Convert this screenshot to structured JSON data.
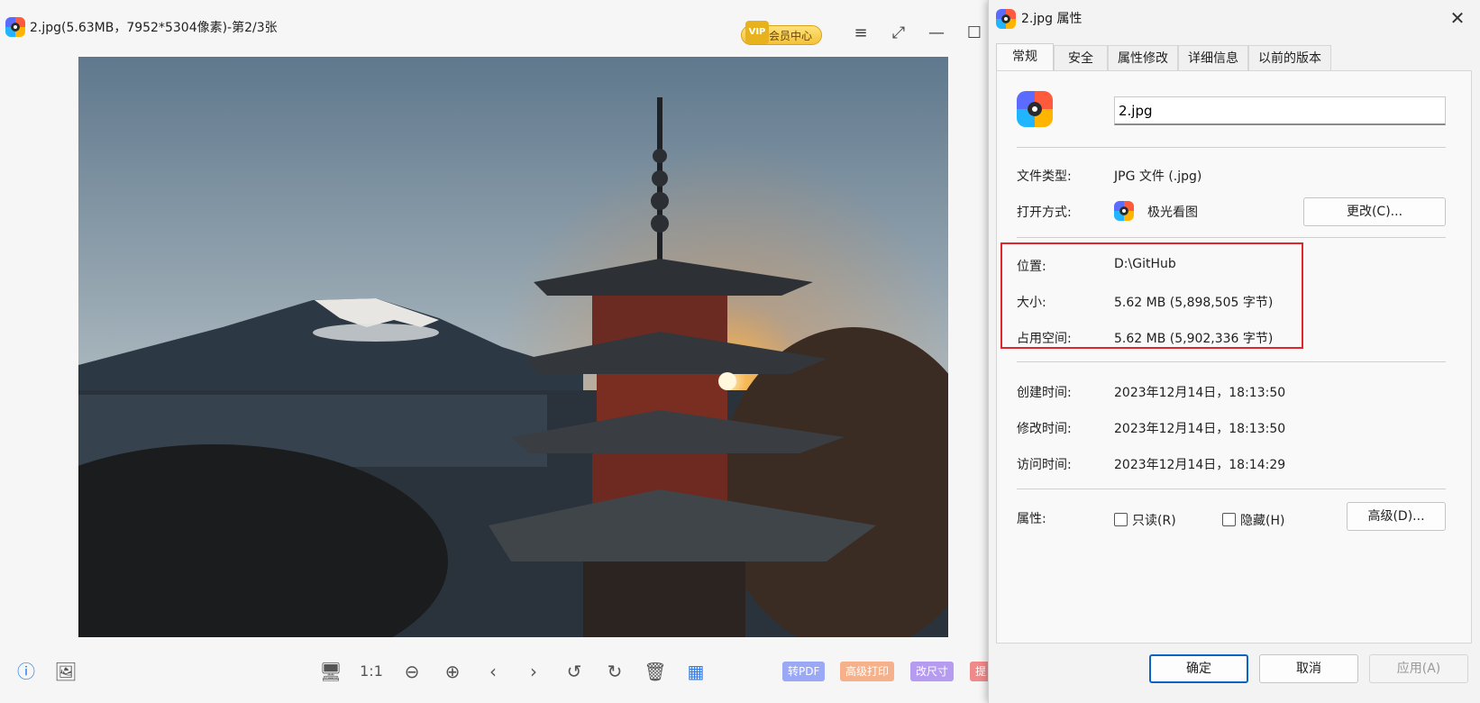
{
  "viewer": {
    "title": "2.jpg(5.63MB，7952*5304像素)-第2/3张",
    "vip_label": "会员中心",
    "vip_crown": "VIP",
    "image_description_icon": "photo",
    "tags": [
      "转PDF",
      "高级打印",
      "改尺寸",
      "提"
    ]
  },
  "dialog": {
    "title": "2.jpg 属性",
    "tabs": [
      "常规",
      "安全",
      "属性修改",
      "详细信息",
      "以前的版本"
    ],
    "file_name": "2.jpg",
    "rows": {
      "file_type_label": "文件类型:",
      "file_type_value": "JPG 文件 (.jpg)",
      "open_with_label": "打开方式:",
      "open_with_value": "极光看图",
      "change_button": "更改(C)...",
      "location_label": "位置:",
      "location_value": "D:\\GitHub",
      "size_label": "大小:",
      "size_value": "5.62 MB (5,898,505 字节)",
      "disk_size_label": "占用空间:",
      "disk_size_value": "5.62 MB (5,902,336 字节)",
      "created_label": "创建时间:",
      "created_value": "2023年12月14日，18:13:50",
      "modified_label": "修改时间:",
      "modified_value": "2023年12月14日，18:13:50",
      "accessed_label": "访问时间:",
      "accessed_value": "2023年12月14日，18:14:29",
      "attributes_label": "属性:",
      "readonly_label": "只读(R)",
      "hidden_label": "隐藏(H)",
      "advanced_button": "高级(D)..."
    },
    "footer": {
      "ok": "确定",
      "cancel": "取消",
      "apply": "应用(A)"
    }
  },
  "colors": {
    "highlight": "#e0262a",
    "primary_border": "#0a64c4",
    "tag_pdf": "#9aa8f5",
    "tag_print": "#f6b08a",
    "tag_resize": "#b59cf0",
    "tag_extra": "#f08a8a"
  }
}
